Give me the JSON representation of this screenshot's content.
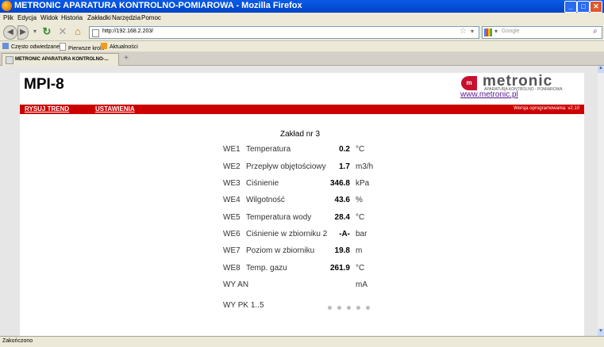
{
  "window": {
    "title": "METRONIC APARATURA KONTROLNO-POMIAROWA - Mozilla Firefox",
    "btn_min": "_",
    "btn_max": "□",
    "btn_close": "✕"
  },
  "menu": [
    "Plik",
    "Edycja",
    "Widok",
    "Historia",
    "Zakładki",
    "Narzędzia",
    "Pomoc"
  ],
  "nav": {
    "url": "http://192.168.2.203/",
    "search_placeholder": "Google"
  },
  "bookmarks": [
    "Często odwiedzane",
    "Pierwsze kroki",
    "Aktualności"
  ],
  "tab": {
    "label": "METRONIC APARATURA KONTROLNO-...",
    "new_tab": "+"
  },
  "page": {
    "title": "MPI-8",
    "logo_text": "metronic",
    "logo_mark": "m",
    "logo_sub": "APARATURA KONTROLNO - POMIAROWA",
    "website": "www.metronic.pl",
    "nav_trend": "RYSUJ TREND",
    "nav_settings": "USTAWIENIA",
    "version": "Wersja oprogramowania: v2.10",
    "plant": "Zakład nr 3",
    "inputs": [
      {
        "ch": "WE1",
        "name": "Temperatura",
        "value": "0.2",
        "unit": "°C"
      },
      {
        "ch": "WE2",
        "name": "Przepływ objętościowy",
        "value": "1.7",
        "unit": "m3/h"
      },
      {
        "ch": "WE3",
        "name": "Ciśnienie",
        "value": "346.8",
        "unit": "kPa"
      },
      {
        "ch": "WE4",
        "name": "Wilgotność",
        "value": "43.6",
        "unit": "%"
      },
      {
        "ch": "WE5",
        "name": "Temperatura wody",
        "value": "28.4",
        "unit": "°C"
      },
      {
        "ch": "WE6",
        "name": "Ciśnienie w zbiorniku 2",
        "value": "-A-",
        "unit": "bar"
      },
      {
        "ch": "WE7",
        "name": "Poziom w zbiorniku",
        "value": "19.8",
        "unit": "m"
      },
      {
        "ch": "WE8",
        "name": "Temp. gazu",
        "value": "261.9",
        "unit": "°C"
      }
    ],
    "analog_out": {
      "label": "WY AN",
      "unit": "mA"
    },
    "relay_out": {
      "label": "WY PK 1..5",
      "states": [
        "off",
        "off",
        "off",
        "off",
        "off"
      ]
    }
  },
  "status": "Zakończono",
  "colors": {
    "accent_red": "#cc0000",
    "titlebar_blue": "#0a5ae6"
  }
}
